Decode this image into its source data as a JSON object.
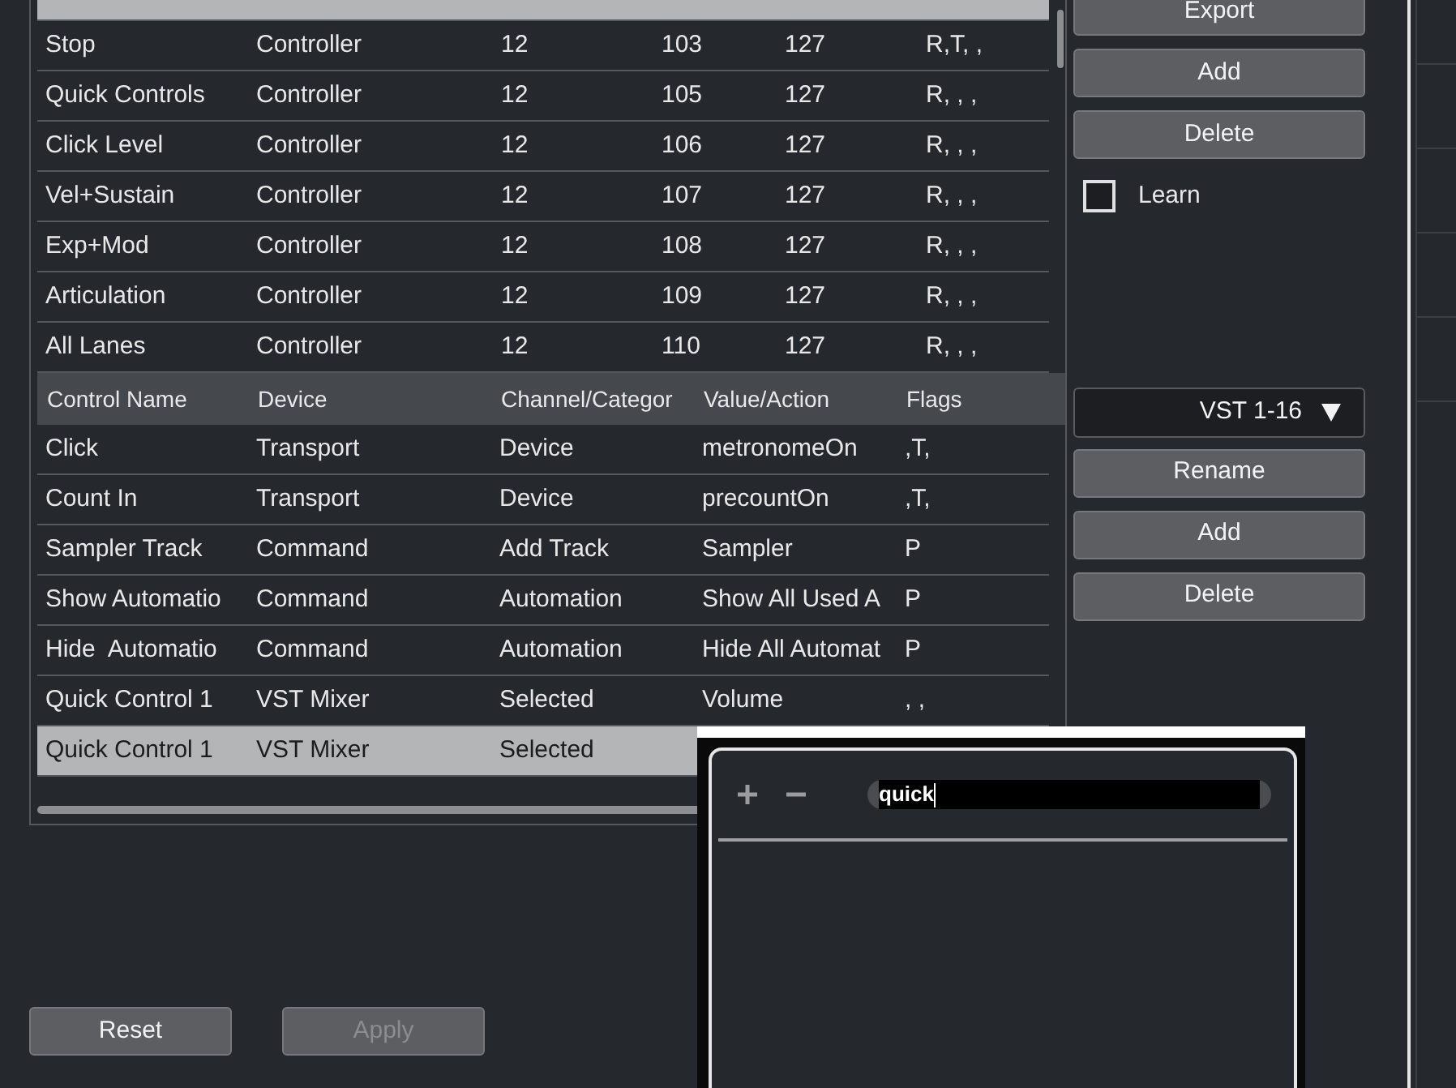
{
  "upper_table": {
    "rows": [
      {
        "selected": true
      },
      {
        "cells": [
          "Stop",
          "Controller",
          "12",
          "103",
          "127",
          "R,T, ,"
        ],
        "selected": false
      },
      {
        "cells": [
          "Quick Controls",
          "Controller",
          "12",
          "105",
          "127",
          "R, , ,"
        ],
        "selected": false
      },
      {
        "cells": [
          "Click Level",
          "Controller",
          "12",
          "106",
          "127",
          "R, , ,"
        ],
        "selected": false
      },
      {
        "cells": [
          "Vel+Sustain",
          "Controller",
          "12",
          "107",
          "127",
          "R, , ,"
        ],
        "selected": false
      },
      {
        "cells": [
          "Exp+Mod",
          "Controller",
          "12",
          "108",
          "127",
          "R, , ,"
        ],
        "selected": false
      },
      {
        "cells": [
          "Articulation",
          "Controller",
          "12",
          "109",
          "127",
          "R, , ,"
        ],
        "selected": false
      },
      {
        "cells": [
          "All Lanes",
          "Controller",
          "12",
          "110",
          "127",
          "R, , ,"
        ],
        "selected": false
      }
    ]
  },
  "upper_buttons": [
    {
      "label": "Export"
    },
    {
      "label": "Add"
    },
    {
      "label": "Delete"
    }
  ],
  "learn": {
    "label": "Learn",
    "checked": false
  },
  "lower_table": {
    "columns": [
      "Control Name",
      "Device",
      "Channel/Categor",
      "Value/Action",
      "Flags"
    ],
    "rows": [
      {
        "cells": [
          "Click",
          "Transport",
          "Device",
          "metronomeOn",
          ",T,"
        ],
        "selected": false
      },
      {
        "cells": [
          "Count In",
          "Transport",
          "Device",
          "precountOn",
          ",T,"
        ],
        "selected": false
      },
      {
        "cells": [
          "Sampler Track",
          "Command",
          "Add Track",
          "Sampler",
          "P"
        ],
        "selected": false
      },
      {
        "cells": [
          "Show Automatio",
          "Command",
          "Automation",
          "Show All Used A",
          "P"
        ],
        "selected": false
      },
      {
        "cells": [
          "Hide  Automatio",
          "Command",
          "Automation",
          "Hide All Automat",
          "P"
        ],
        "selected": false
      },
      {
        "cells": [
          "Quick Control 1",
          "VST Mixer",
          "Selected",
          "Volume",
          ", ,"
        ],
        "selected": false
      },
      {
        "cells": [
          "Quick Control 1",
          "VST Mixer",
          "Selected"
        ],
        "selected": true
      }
    ]
  },
  "bank_dropdown": {
    "value": "VST 1-16"
  },
  "lower_buttons": [
    {
      "label": "Rename"
    },
    {
      "label": "Add"
    },
    {
      "label": "Delete"
    }
  ],
  "footer_buttons": [
    {
      "label": "Reset",
      "disabled": false
    },
    {
      "label": "Apply",
      "disabled": true
    }
  ],
  "popup": {
    "search": {
      "value": "quick"
    }
  }
}
